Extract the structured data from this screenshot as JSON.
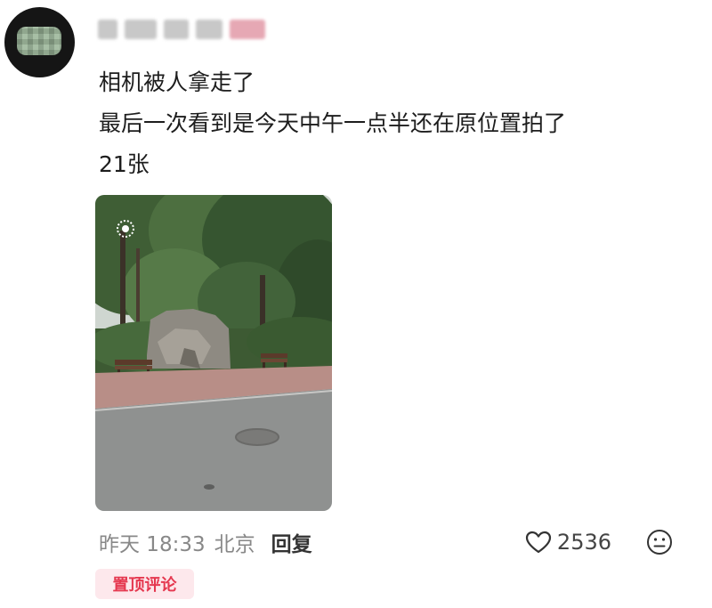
{
  "comment": {
    "text_lines": [
      "相机被人拿走了",
      "最后一次看到是今天中午一点半还在原位置拍了",
      "21张"
    ],
    "timestamp": "昨天 18:33",
    "location": "北京",
    "reply_label": "回复",
    "likes": "2536",
    "pinned_label": "置顶评论"
  },
  "colors": {
    "accent": "#e5384f",
    "pin_bg": "#fde8ec",
    "meta_text": "#888888",
    "text": "#1d1d1d"
  },
  "icons": {
    "like": "heart-outline-icon",
    "emoji": "neutral-face-icon",
    "live_photo": "live-photo-icon"
  }
}
